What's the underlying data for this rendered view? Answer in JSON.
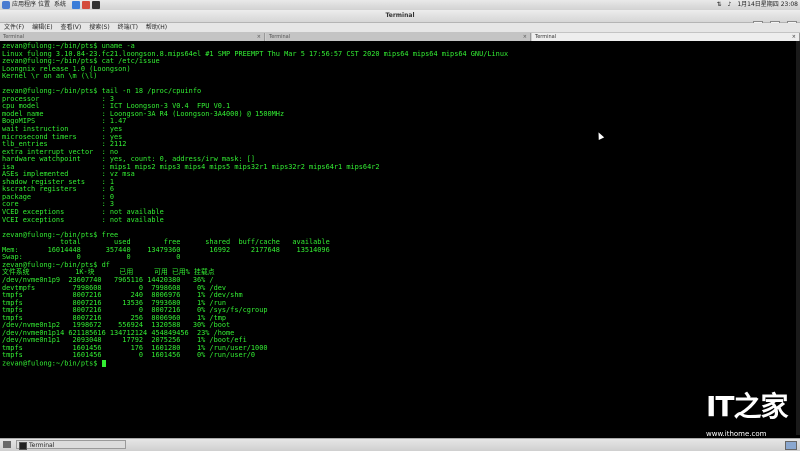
{
  "top_panel": {
    "applications": "应用程序",
    "places": "位置",
    "system": "系统",
    "datetime": "1月14日星期四 23:08"
  },
  "window": {
    "title": "Terminal"
  },
  "menubar": [
    "文件(F)",
    "编辑(E)",
    "查看(V)",
    "搜索(S)",
    "终端(T)",
    "帮助(H)"
  ],
  "tabs": [
    {
      "label": "Terminal",
      "active": false
    },
    {
      "label": "Terminal",
      "active": false
    },
    {
      "label": "Terminal",
      "active": true
    }
  ],
  "terminal": {
    "lines": [
      "zevan@fulong:~/bin/pts$ uname -a",
      "Linux fulong 3.10.84-23.fc21.loongson.8.mips64el #1 SMP PREEMPT Thu Mar 5 17:56:57 CST 2020 mips64 mips64 mips64 GNU/Linux",
      "zevan@fulong:~/bin/pts$ cat /etc/issue",
      "Loongnix release 1.0 (Loongson)",
      "Kernel \\r on an \\m (\\l)",
      "",
      "zevan@fulong:~/bin/pts$ tail -n 18 /proc/cpuinfo",
      "processor               : 3",
      "cpu model               : ICT Loongson-3 V0.4  FPU V0.1",
      "model name              : Loongson-3A R4 (Loongson-3A4000) @ 1500MHz",
      "BogoMIPS                : 1.47",
      "wait instruction        : yes",
      "microsecond timers      : yes",
      "tlb_entries             : 2112",
      "extra interrupt vector  : no",
      "hardware watchpoint     : yes, count: 0, address/irw mask: []",
      "isa                     : mips1 mips2 mips3 mips4 mips5 mips32r1 mips32r2 mips64r1 mips64r2",
      "ASEs implemented        : vz msa",
      "shadow register sets    : 1",
      "kscratch registers      : 6",
      "package                 : 0",
      "core                    : 3",
      "VCED exceptions         : not available",
      "VCEI exceptions         : not available",
      "",
      "zevan@fulong:~/bin/pts$ free",
      "              total        used        free      shared  buff/cache   available",
      "Mem:       16014448      357440    13479360       16992     2177648    13514096",
      "Swap:             0           0           0",
      "zevan@fulong:~/bin/pts$ df",
      "文件系统           1K-块      已用     可用 已用% 挂载点",
      "/dev/nvme0n1p9  23607740   7965116 14420380   36% /",
      "devtmpfs         7998608         0  7998608    0% /dev",
      "tmpfs            8007216       240  8006976    1% /dev/shm",
      "tmpfs            8007216     13536  7993680    1% /run",
      "tmpfs            8007216         0  8007216    0% /sys/fs/cgroup",
      "tmpfs            8007216       256  8006960    1% /tmp",
      "/dev/nvme0n1p2   1998672    556924  1320588   30% /boot",
      "/dev/nvme0n1p14 621185616 134712124 454849456  23% /home",
      "/dev/nvme0n1p1   2093048     17792  2075256    1% /boot/efi",
      "tmpfs            1601456       176  1601280    1% /run/user/1000",
      "tmpfs            1601456         0  1601456    0% /run/user/0",
      "zevan@fulong:~/bin/pts$ "
    ]
  },
  "watermark": {
    "logo_text": "IT之家",
    "url": "www.ithome.com"
  },
  "taskbar": {
    "item_label": "Terminal"
  }
}
